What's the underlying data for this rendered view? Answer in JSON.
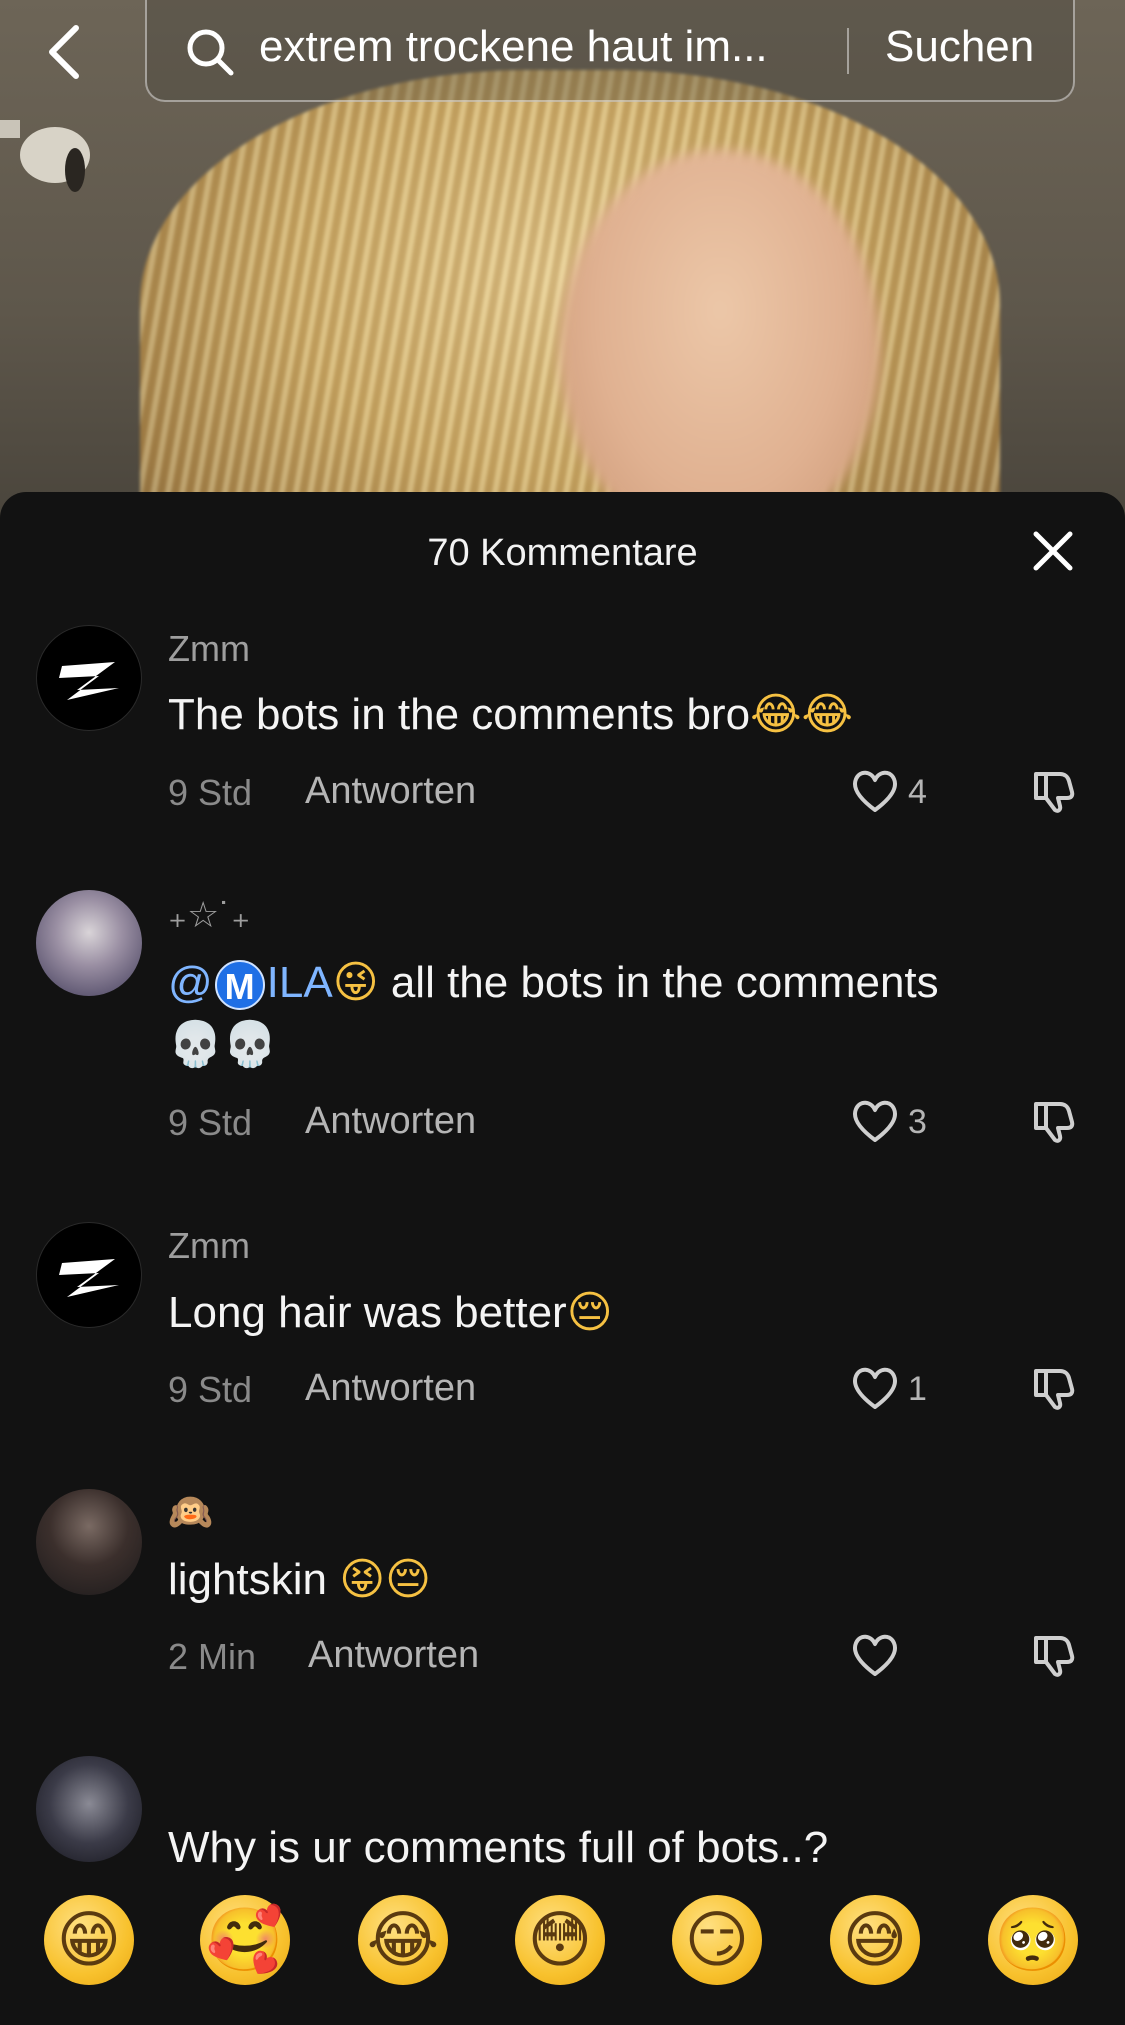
{
  "search": {
    "query": "extrem trockene haut im...",
    "button_label": "Suchen"
  },
  "comments_sheet": {
    "title": "70 Kommentare",
    "comments": [
      {
        "username": "Zmm",
        "text": "The bots in the comments bro",
        "emojis": "😂😂",
        "time": "9 Std",
        "reply_label": "Antworten",
        "likes": "4"
      },
      {
        "username": "₊☆˙₊",
        "mention_prefix": "@",
        "mention_badge": "M",
        "mention_name": "ILA",
        "mention_emoji": "😜",
        "text": "all the bots in the comments",
        "skulls": "💀💀",
        "time": "9 Std",
        "reply_label": "Antworten",
        "likes": "3"
      },
      {
        "username": "Zmm",
        "text": "Long hair was better",
        "emojis": "😔",
        "time": "9 Std",
        "reply_label": "Antworten",
        "likes": "1"
      },
      {
        "username": "🙉",
        "text": "lightskin",
        "emojis": "😝😔",
        "time": "2 Min",
        "reply_label": "Antworten",
        "likes": ""
      },
      {
        "username": "",
        "text": "Why is ur comments full of bots..?"
      }
    ]
  },
  "emoji_bar": [
    "😁",
    "🥰",
    "😂",
    "😳",
    "😏",
    "😅",
    "🥺"
  ]
}
